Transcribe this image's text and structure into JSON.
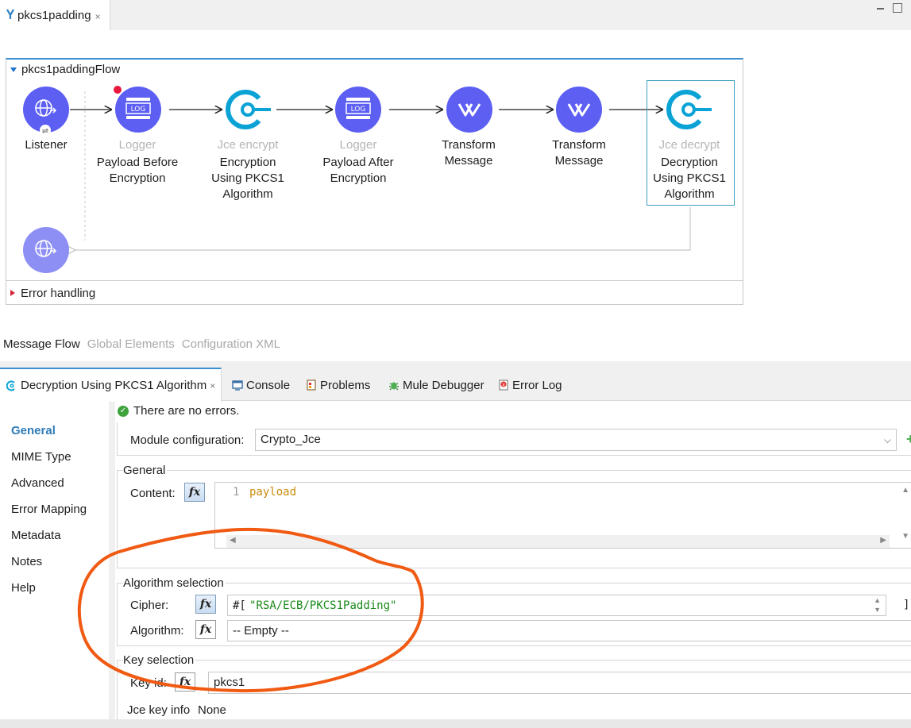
{
  "editor": {
    "tab_label": "pkcs1padding",
    "tab_close": "×"
  },
  "flow": {
    "name": "pkcs1paddingFlow",
    "nodes": [
      {
        "type_label": "",
        "label": "Listener"
      },
      {
        "type_label": "Logger",
        "label_line1": "Payload Before",
        "label_line2": "Encryption"
      },
      {
        "type_label": "Jce encrypt",
        "label_line1": "Encryption",
        "label_line2": "Using PKCS1",
        "label_line3": "Algorithm"
      },
      {
        "type_label": "Logger",
        "label_line1": "Payload After",
        "label_line2": "Encryption"
      },
      {
        "type_label": "",
        "label_line1": "Transform",
        "label_line2": "Message"
      },
      {
        "type_label": "",
        "label_line1": "Transform",
        "label_line2": "Message"
      },
      {
        "type_label": "Jce decrypt",
        "label_line1": "Decryption",
        "label_line2": "Using PKCS1",
        "label_line3": "Algorithm"
      }
    ],
    "logger_icon_text": "LOG",
    "error_handling": "Error handling"
  },
  "view_tabs": {
    "message_flow": "Message Flow",
    "global_elements": "Global Elements",
    "configuration_xml": "Configuration XML"
  },
  "panel_tabs": {
    "properties": "Decryption Using PKCS1 Algorithm",
    "properties_close": "×",
    "console": "Console",
    "problems": "Problems",
    "debugger": "Mule Debugger",
    "error_log": "Error Log"
  },
  "side_nav": {
    "items": [
      "General",
      "MIME Type",
      "Advanced",
      "Error Mapping",
      "Metadata",
      "Notes",
      "Help"
    ],
    "active": "General"
  },
  "status": {
    "message": "There are no errors.",
    "icon": "check-circle-icon"
  },
  "basic_settings": {
    "module_config_label": "Module configuration:",
    "module_config_value": "Crypto_Jce"
  },
  "general": {
    "title": "General",
    "content_label": "Content:",
    "fx": "fx",
    "line_number": "1",
    "content_value": "payload"
  },
  "algorithm_selection": {
    "title": "Algorithm selection",
    "cipher_label": "Cipher:",
    "cipher_prefix": "#[",
    "cipher_value": "\"RSA/ECB/PKCS1Padding\"",
    "cipher_suffix": "]",
    "algorithm_label": "Algorithm:",
    "algorithm_value": "-- Empty --"
  },
  "key_selection": {
    "title": "Key selection",
    "key_id_label": "Key id:",
    "key_id_value": "pkcs1",
    "key_info_label": "Jce key info",
    "key_info_value": "None"
  },
  "colors": {
    "node_purple": "#5c5ff2",
    "jce_blue": "#0ba3d6",
    "annotation_orange": "#f05a12",
    "active_tab_blue": "#3a8fd0"
  }
}
